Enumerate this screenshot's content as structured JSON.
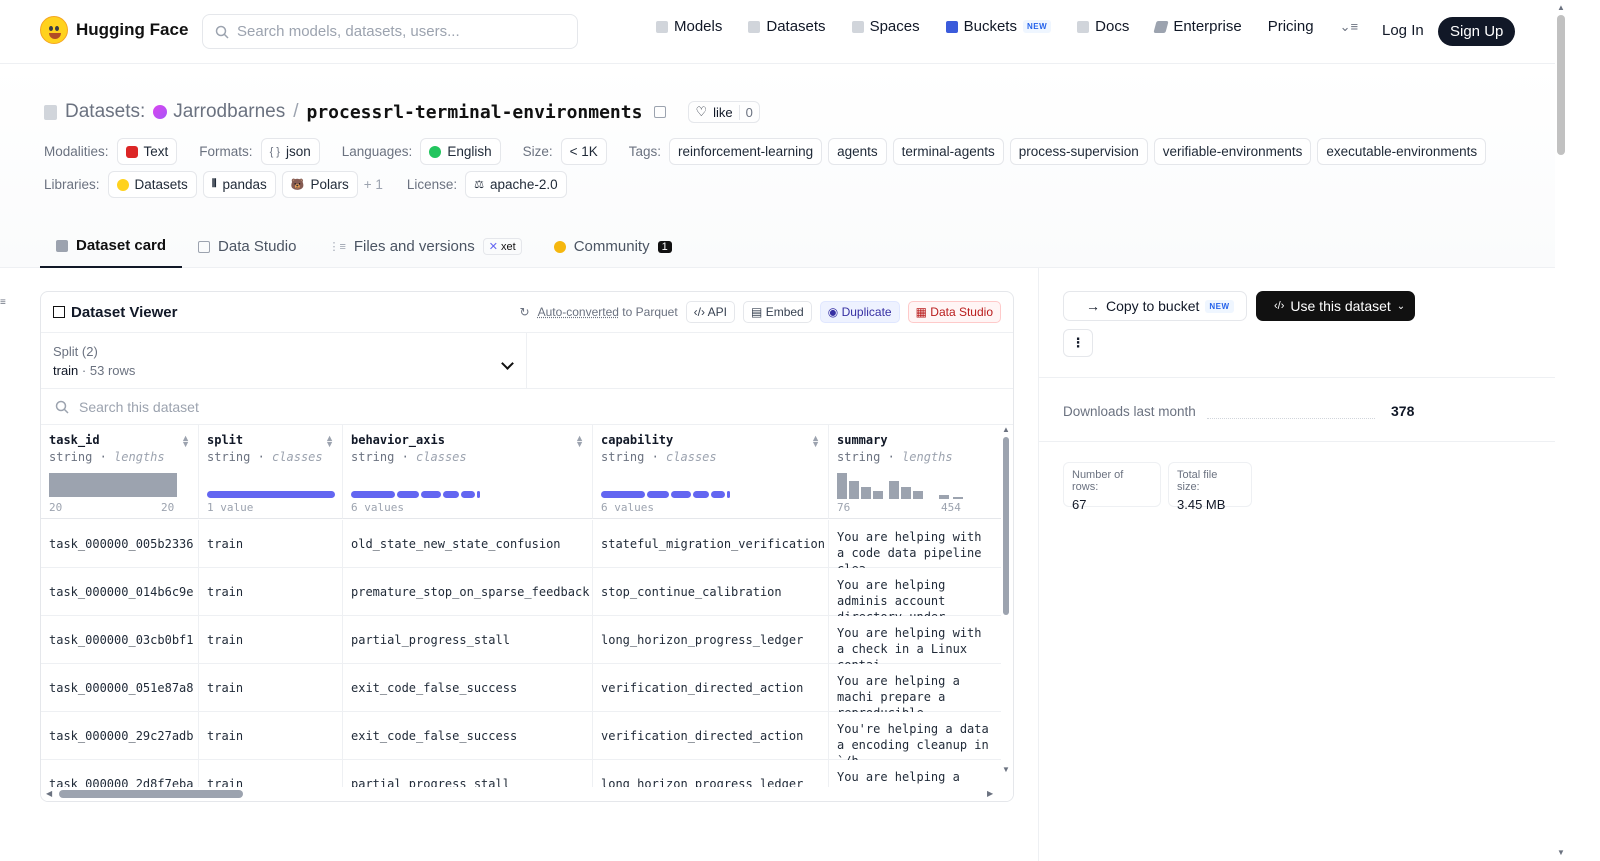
{
  "nav": {
    "brand": "Hugging Face",
    "search_placeholder": "Search models, datasets, users...",
    "links": [
      "Models",
      "Datasets",
      "Spaces",
      "Buckets",
      "Docs",
      "Enterprise",
      "Pricing"
    ],
    "buckets_badge": "NEW",
    "login": "Log In",
    "signup": "Sign Up"
  },
  "header": {
    "prefix": "Datasets:",
    "owner": "Jarrodbarnes",
    "separator": "/",
    "name": "processrl-terminal-environments",
    "like_label": "like",
    "like_count": "0",
    "modalities_label": "Modalities:",
    "modality": "Text",
    "formats_label": "Formats:",
    "format": "json",
    "languages_label": "Languages:",
    "language": "English",
    "size_label": "Size:",
    "size": "< 1K",
    "tags_label": "Tags:",
    "tags": [
      "reinforcement-learning",
      "agents",
      "terminal-agents",
      "process-supervision",
      "verifiable-environments",
      "executable-environments"
    ],
    "libraries_label": "Libraries:",
    "libraries": [
      "Datasets",
      "pandas",
      "Polars"
    ],
    "libraries_more": "+ 1",
    "license_label": "License:",
    "license": "apache-2.0"
  },
  "tabs": {
    "card": "Dataset card",
    "studio": "Data Studio",
    "files": "Files and versions",
    "xet": "xet",
    "community": "Community",
    "community_count": "1"
  },
  "viewer": {
    "title": "Dataset Viewer",
    "auto": "Auto-converted",
    "to_parquet": "to Parquet",
    "api": "API",
    "embed": "Embed",
    "duplicate": "Duplicate",
    "data_studio": "Data Studio",
    "split_label": "Split (2)",
    "split_value": "train",
    "split_rows": "53 rows",
    "search_placeholder": "Search this dataset",
    "columns": [
      {
        "name": "task_id",
        "type": "string",
        "stat": "lengths",
        "min": "20",
        "max": "20"
      },
      {
        "name": "split",
        "type": "string",
        "stat": "classes",
        "values": "1 value"
      },
      {
        "name": "behavior_axis",
        "type": "string",
        "stat": "classes",
        "values": "6 values"
      },
      {
        "name": "capability",
        "type": "string",
        "stat": "classes",
        "values": "6 values"
      },
      {
        "name": "summary",
        "type": "string",
        "stat": "lengths",
        "min": "76",
        "max": "454"
      }
    ],
    "rows": [
      [
        "task_000000_005b2336",
        "train",
        "old_state_new_state_confusion",
        "stateful_migration_verification",
        "You are helping with a code data pipeline clea"
      ],
      [
        "task_000000_014b6c9e",
        "train",
        "premature_stop_on_sparse_feedback",
        "stop_continue_calibration",
        "You are helping adminis account directory under"
      ],
      [
        "task_000000_03cb0bf1",
        "train",
        "partial_progress_stall",
        "long_horizon_progress_ledger",
        "You are helping with a check in a Linux contai"
      ],
      [
        "task_000000_051e87a8",
        "train",
        "exit_code_false_success",
        "verification_directed_action",
        "You are helping a machi prepare a reproducible"
      ],
      [
        "task_000000_29c27adb",
        "train",
        "exit_code_false_success",
        "verification_directed_action",
        "You're helping a data a encoding cleanup in `/h"
      ],
      [
        "task_000000_2d8f7eba",
        "train",
        "partial_progress_stall",
        "long_horizon_progress_ledger",
        "You are helping a relea"
      ]
    ]
  },
  "side": {
    "copy_bucket": "Copy to bucket",
    "copy_badge": "NEW",
    "use_dataset": "Use this dataset",
    "downloads_label": "Downloads last month",
    "downloads": "378",
    "rows_label": "Number of rows:",
    "rows_value": "67",
    "size_label": "Total file size:",
    "size_value": "3.45 MB"
  }
}
